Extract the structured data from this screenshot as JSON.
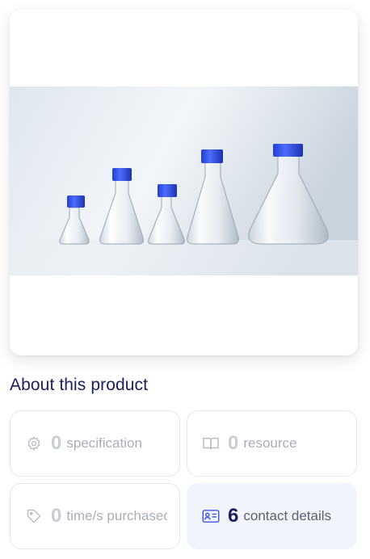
{
  "product_image": {
    "alt": "Erlenmeyer flasks with blue caps"
  },
  "about": {
    "title": "About this product",
    "stats": [
      {
        "count": "0",
        "label": "specification",
        "icon": "gear-icon"
      },
      {
        "count": "0",
        "label": "resource",
        "icon": "book-icon"
      },
      {
        "count": "0",
        "label": "time/s purchased",
        "icon": "tag-icon"
      },
      {
        "count": "6",
        "label": "contact details",
        "icon": "contact-card-icon"
      }
    ]
  },
  "colors": {
    "title": "#1b1f5e",
    "accent_blue": "#3b56e6",
    "muted": "#a9aeb8",
    "active_bg": "#f1f5fb"
  }
}
